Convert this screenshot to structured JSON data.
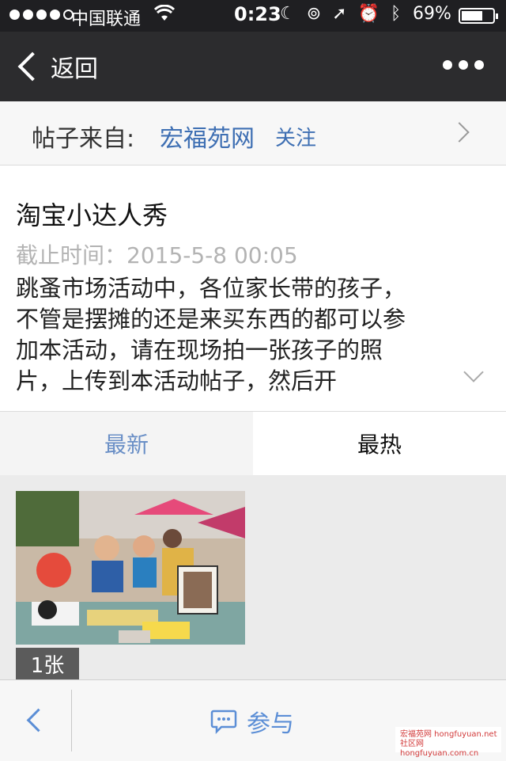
{
  "status_bar": {
    "carrier": "中国联通",
    "time": "0:23",
    "battery_percent": "69%",
    "battery_level": 0.69,
    "signal_bars_filled": 4,
    "signal_bars_total": 5,
    "icons": [
      "moon-icon",
      "orientation-lock-icon",
      "location-icon",
      "alarm-icon",
      "bluetooth-icon"
    ]
  },
  "nav": {
    "back_label": "返回"
  },
  "source": {
    "prefix": "帖子来自:",
    "site_name": "宏福苑网",
    "follow_label": "关注"
  },
  "post": {
    "title": "淘宝小达人秀",
    "deadline": "截止时间：2015-5-8 00:05",
    "body": "跳蚤市场活动中，各位家长带的孩子，不管是摆摊的还是来买东西的都可以参加本活动，请在现场拍一张孩子的照片，上传到本活动帖子，然后开"
  },
  "tabs": {
    "latest": "最新",
    "hottest": "最热",
    "active": "hottest"
  },
  "entries": [
    {
      "photo_count": "1张"
    }
  ],
  "bottom_bar": {
    "join_label": "参与"
  },
  "watermark": {
    "line1": "宏福苑网 hongfuyuan.net",
    "line2": "社区网 hongfuyuan.com.cn"
  },
  "colors": {
    "accent_blue": "#3e6fb3",
    "tab_blue": "#6a8fc6",
    "nav_dark": "#2c2c2e"
  }
}
